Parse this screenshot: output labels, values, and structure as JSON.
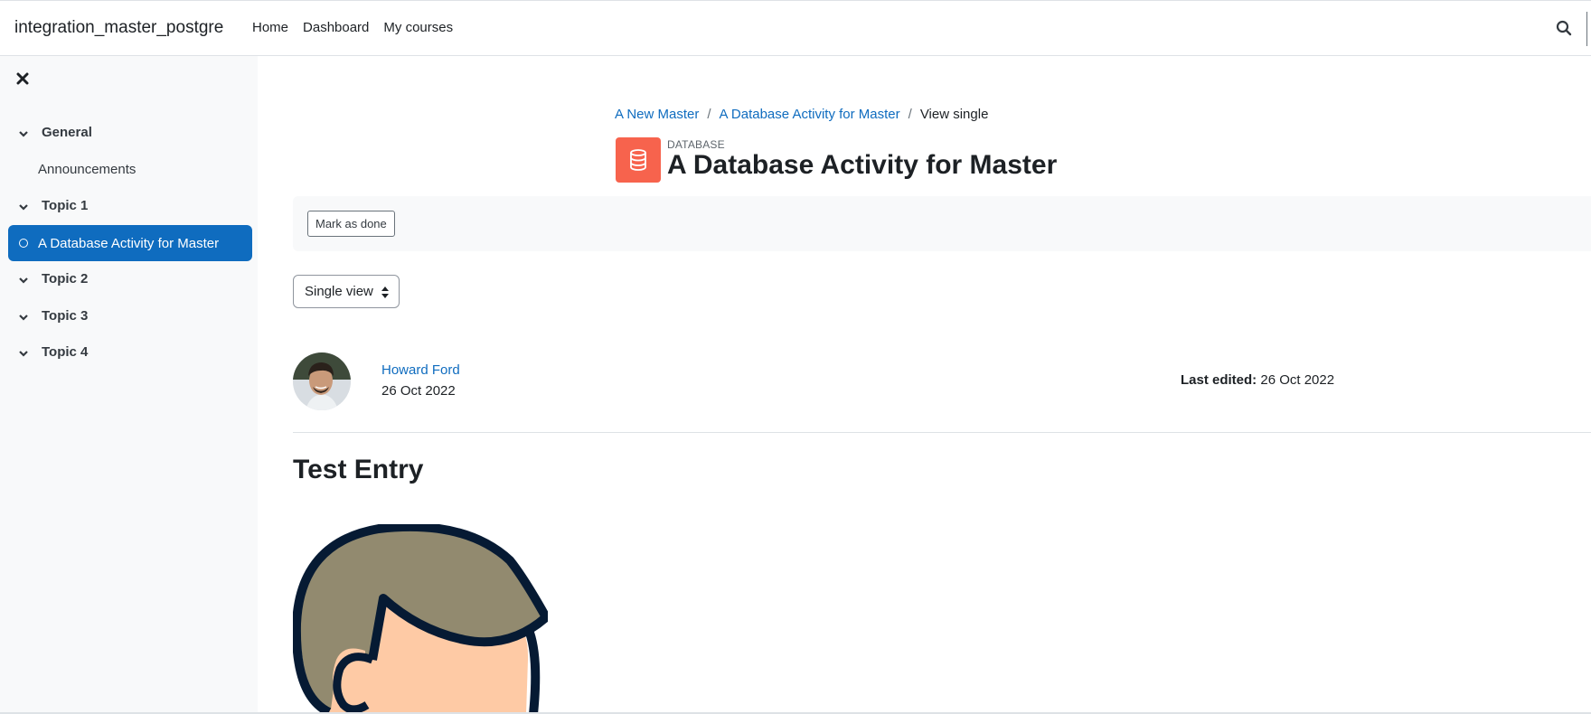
{
  "navbar": {
    "site_name": "integration_master_postgre",
    "links": [
      "Home",
      "Dashboard",
      "My courses"
    ]
  },
  "course_index": {
    "sections": [
      {
        "label": "General",
        "items": [
          "Announcements"
        ]
      },
      {
        "label": "Topic 1",
        "items": [
          "A Database Activity for Master"
        ]
      },
      {
        "label": "Topic 2",
        "items": []
      },
      {
        "label": "Topic 3",
        "items": []
      },
      {
        "label": "Topic 4",
        "items": []
      }
    ],
    "active_item": "A Database Activity for Master"
  },
  "breadcrumb": {
    "items": [
      "A New Master",
      "A Database Activity for Master"
    ],
    "current": "View single"
  },
  "header": {
    "activity_type": "DATABASE",
    "title": "A Database Activity for Master"
  },
  "completion": {
    "mark_done_label": "Mark as done"
  },
  "view_selector": {
    "selected": "Single view"
  },
  "entry": {
    "author": "Howard Ford",
    "created": "26 Oct 2022",
    "last_edited_label": "Last edited:",
    "last_edited": "26 Oct 2022",
    "title": "Test Entry"
  },
  "colors": {
    "primary": "#0f6cbf",
    "database_icon_bg": "#f7634d",
    "drawer_bg": "#f8f9fa"
  }
}
